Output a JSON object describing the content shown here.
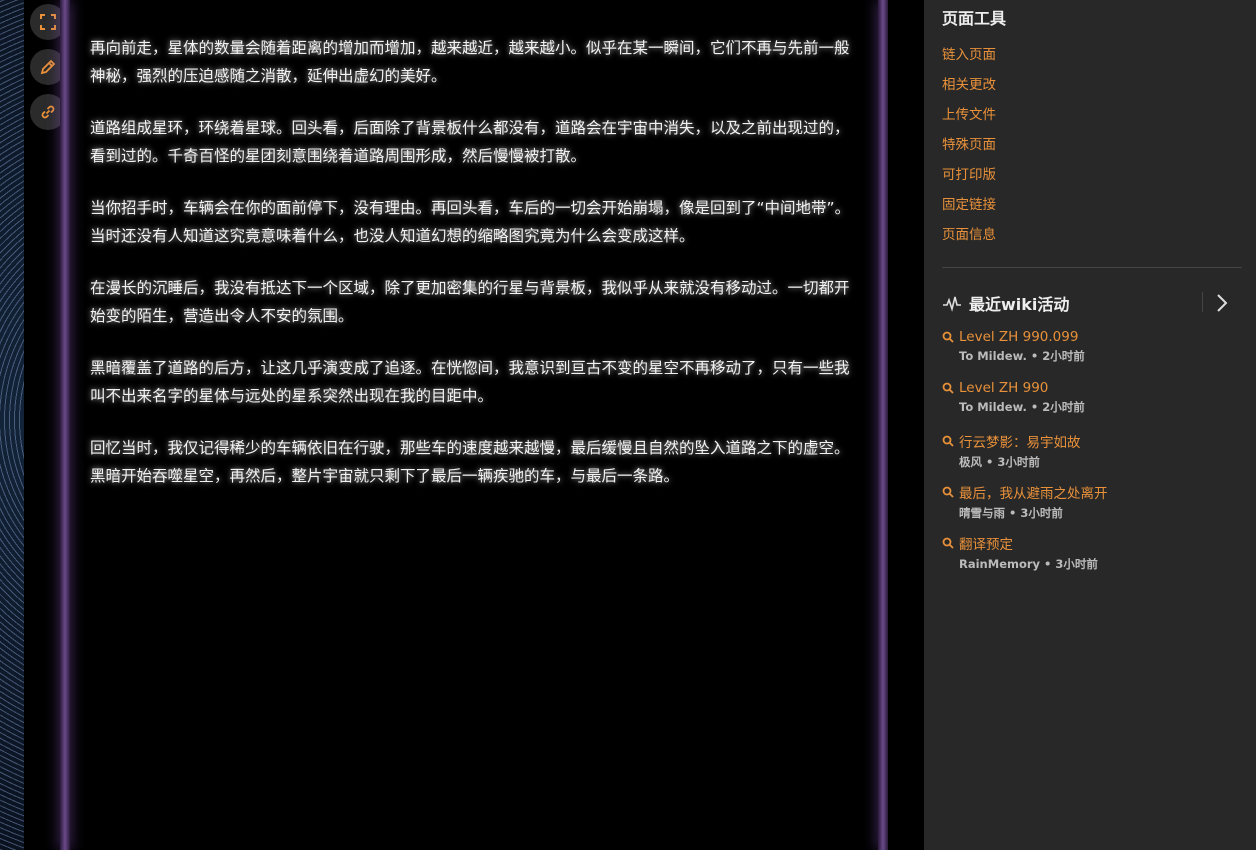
{
  "side_buttons": [
    {
      "icon": "fullscreen-icon"
    },
    {
      "icon": "edit-icon"
    },
    {
      "icon": "link-icon"
    }
  ],
  "article": {
    "paragraphs": [
      "再向前走，星体的数量会随着距离的增加而增加，越来越近，越来越小。似乎在某一瞬间，它们不再与先前一般神秘，强烈的压迫感随之消散，延伸出虚幻的美好。",
      "道路组成星环，环绕着星球。回头看，后面除了背景板什么都没有，道路会在宇宙中消失，以及之前出现过的，看到过的。千奇百怪的星团刻意围绕着道路周围形成，然后慢慢被打散。",
      "当你招手时，车辆会在你的面前停下，没有理由。再回头看，车后的一切会开始崩塌，像是回到了“中间地带”。当时还没有人知道这究竟意味着什么，也没人知道幻想的缩略图究竟为什么会变成这样。",
      "在漫长的沉睡后，我没有抵达下一个区域，除了更加密集的行星与背景板，我似乎从来就没有移动过。一切都开始变的陌生，营造出令人不安的氛围。",
      "黑暗覆盖了道路的后方，让这几乎演变成了追逐。在恍惚间，我意识到亘古不变的星空不再移动了，只有一些我叫不出来名字的星体与远处的星系突然出现在我的目距中。",
      "回忆当时，我仅记得稀少的车辆依旧在行驶，那些车的速度越来越慢，最后缓慢且自然的坠入道路之下的虚空。黑暗开始吞噬星空，再然后，整片宇宙就只剩下了最后一辆疾驰的车，与最后一条路。"
    ]
  },
  "sidebar": {
    "tools_title": "页面工具",
    "tools": [
      "链入页面",
      "相关更改",
      "上传文件",
      "特殊页面",
      "可打印版",
      "固定链接",
      "页面信息"
    ],
    "recent_title": "最近wiki活动",
    "activities": [
      {
        "title": "Level ZH 990.099",
        "meta": "To Mildew. • 2小时前"
      },
      {
        "title": "Level ZH 990",
        "meta": "To Mildew. • 2小时前"
      },
      {
        "title": "行云梦影：易宇如故",
        "meta": "极风 • 3小时前"
      },
      {
        "title": "最后，我从避雨之处离开",
        "meta": "晴雪与雨 • 3小时前"
      },
      {
        "title": "翻译预定",
        "meta": "RainMemory • 3小时前"
      }
    ]
  },
  "colors": {
    "accent": "#e8913a",
    "sidebar_bg": "#282828",
    "frame_glow": "#6a4a8a"
  }
}
